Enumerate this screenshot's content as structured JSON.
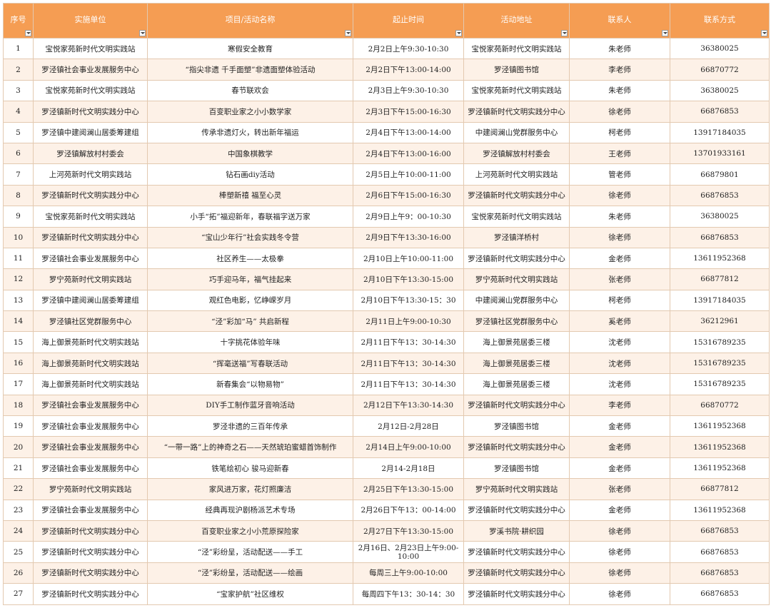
{
  "headers": [
    "序号",
    "实施单位",
    "项目/活动名称",
    "起止时间",
    "活动地址",
    "联系人",
    "联系方式"
  ],
  "rows": [
    [
      "1",
      "宝悦家苑新时代文明实践站",
      "寒假安全教育",
      "2月2日上午9:30-10:30",
      "宝悦家苑新时代文明实践站",
      "朱老师",
      "36380025"
    ],
    [
      "2",
      "罗泾镇社会事业发展服务中心",
      "“指尖非遗 千手面塑”非遗面塑体验活动",
      "2月2日下午13:00-14:00",
      "罗泾镇图书馆",
      "李老师",
      "66870772"
    ],
    [
      "3",
      "宝悦家苑新时代文明实践站",
      "春节联欢会",
      "2月3日上午9:30-10:30",
      "宝悦家苑新时代文明实践站",
      "朱老师",
      "36380025"
    ],
    [
      "4",
      "罗泾镇新时代文明实践分中心",
      "百变职业家之小小数学家",
      "2月3日下午15:00-16:30",
      "罗泾镇新时代文明实践分中心",
      "徐老师",
      "66876853"
    ],
    [
      "5",
      "罗泾镇中建阅澜山居委筹建组",
      "传承非遗灯火，转出新年福运",
      "2月4日下午13:00-14:00",
      "中建阅澜山党群服务中心",
      "柯老师",
      "13917184035"
    ],
    [
      "6",
      "罗泾镇解放村村委会",
      "中国象棋教学",
      "2月4日下午13:00-16:00",
      "罗泾镇解放村村委会",
      "王老师",
      "13701933161"
    ],
    [
      "7",
      "上河苑新时代文明实践站",
      "钻石画diy活动",
      "2月5日上午10:00-11:00",
      "上河苑新时代文明实践站",
      "管老师",
      "66879801"
    ],
    [
      "8",
      "罗泾镇新时代文明实践分中心",
      "棒塑新禧 福至心灵",
      "2月6日下午15:00-16:30",
      "罗泾镇新时代文明实践分中心",
      "徐老师",
      "66876853"
    ],
    [
      "9",
      "宝悦家苑新时代文明实践站",
      "小手“拓”福迎新年，春联福字送万家",
      "2月9日上午9：00-10:30",
      "宝悦家苑新时代文明实践站",
      "朱老师",
      "36380025"
    ],
    [
      "10",
      "罗泾镇新时代文明实践分中心",
      "“宝山少年行”社会实践冬令营",
      "2月9日下午13:30-16:00",
      "罗泾镇洋桥村",
      "徐老师",
      "66876853"
    ],
    [
      "11",
      "罗泾镇社会事业发展服务中心",
      "社区养生——太极拳",
      "2月10日上午10:00-11:00",
      "罗泾镇新时代文明实践分中心",
      "金老师",
      "13611952368"
    ],
    [
      "12",
      "罗宁苑新时代文明实践站",
      "巧手迎马年，福气挂起来",
      "2月10日下午13:30-15:00",
      "罗宁苑新时代文明实践站",
      "张老师",
      "66877812"
    ],
    [
      "13",
      "罗泾镇中建阅澜山居委筹建组",
      "观红色电影，忆峥嵘岁月",
      "2月10日下午13:30-15：30",
      "中建阅澜山党群服务中心",
      "柯老师",
      "13917184035"
    ],
    [
      "14",
      "罗泾镇社区党群服务中心",
      "“泾”彩加“马” 共启新程",
      "2月11日上午9:00-10:30",
      "罗泾镇社区党群服务中心",
      "奚老师",
      "36212961"
    ],
    [
      "15",
      "海上御景苑新时代文明实践站",
      "十字挑花体验年味",
      "2月11日下午13：30-14:30",
      "海上御景苑居委三楼",
      "沈老师",
      "15316789235"
    ],
    [
      "16",
      "海上御景苑新时代文明实践站",
      "“挥毫送福”写春联活动",
      "2月11日下午13：30-14:30",
      "海上御景苑居委三楼",
      "沈老师",
      "15316789235"
    ],
    [
      "17",
      "海上御景苑新时代文明实践站",
      "新春集会“以物易物”",
      "2月11日下午13：30-14:30",
      "海上御景苑居委三楼",
      "沈老师",
      "15316789235"
    ],
    [
      "18",
      "罗泾镇社会事业发展服务中心",
      "DIY手工制作蓝牙音响活动",
      "2月12日下午13:30-14:30",
      "罗泾镇新时代文明实践分中心",
      "李老师",
      "66870772"
    ],
    [
      "19",
      "罗泾镇社会事业发展服务中心",
      "罗泾非遗的三百年传承",
      "2月12日-2月28日",
      "罗泾镇图书馆",
      "金老师",
      "13611952368"
    ],
    [
      "20",
      "罗泾镇社会事业发展服务中心",
      "“一带一路”上的神奇之石——天然琥珀蜜蜡首饰制作",
      "2月14日上午9:00-10:00",
      "罗泾镇新时代文明实践分中心",
      "金老师",
      "13611952368"
    ],
    [
      "21",
      "罗泾镇社会事业发展服务中心",
      "铁笔绘初心 骏马迎新春",
      "2月14-2月18日",
      "罗泾镇图书馆",
      "金老师",
      "13611952368"
    ],
    [
      "22",
      "罗宁苑新时代文明实践站",
      "家风进万家，花灯照廉洁",
      "2月25日下午13:30-15:00",
      "罗宁苑新时代文明实践站",
      "张老师",
      "66877812"
    ],
    [
      "23",
      "罗泾镇社会事业发展服务中心",
      "经典再现沪剧杨派艺术专场",
      "2月26日下午13：00-14:00",
      "罗泾镇新时代文明实践分中心",
      "金老师",
      "13611952368"
    ],
    [
      "24",
      "罗泾镇新时代文明实践分中心",
      "百变职业家之小小荒原探险家",
      "2月27日下午13:30-15:00",
      "罗溪书院·耕织园",
      "徐老师",
      "66876853"
    ],
    [
      "25",
      "罗泾镇新时代文明实践分中心",
      "“泾”彩纷呈，活动配送——手工",
      "2月16日、2月23日上午9:00-10:00",
      "罗泾镇新时代文明实践分中心",
      "徐老师",
      "66876853"
    ],
    [
      "26",
      "罗泾镇新时代文明实践分中心",
      "“泾”彩纷呈，活动配送——绘画",
      "每周三上午9:00-10:00",
      "罗泾镇新时代文明实践分中心",
      "徐老师",
      "66876853"
    ],
    [
      "27",
      "罗泾镇新时代文明实践分中心",
      "“宝家护航”社区维权",
      "每周四下午13：30-14：30",
      "罗泾镇新时代文明实践分中心",
      "徐老师",
      "66876853"
    ]
  ],
  "colors": {
    "header_bg": "#f59d53",
    "header_text": "#ffffff",
    "stripe": "#fdf1e7",
    "border": "#e3c9b0"
  }
}
